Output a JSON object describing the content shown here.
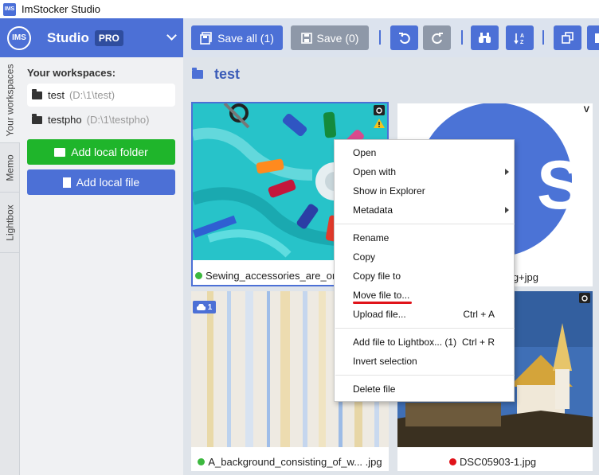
{
  "window": {
    "title": "ImStocker Studio",
    "icon_text": "IMS"
  },
  "header": {
    "logo_text": "IMS",
    "studio_label": "Studio",
    "pro_badge": "PRO",
    "save_all_label": "Save all (1)",
    "save_label": "Save (0)"
  },
  "left_tabs": [
    "Your workspaces",
    "Memo",
    "Lightbox"
  ],
  "workspaces": {
    "title": "Your workspaces:",
    "items": [
      {
        "name": "test",
        "path": "(D:\\1\\test)"
      },
      {
        "name": "testpho",
        "path": "(D:\\1\\testpho)"
      }
    ],
    "add_folder_label": "Add local folder",
    "add_file_label": "Add local file"
  },
  "main": {
    "folder_title": "test",
    "files": [
      {
        "name": "Sewing_accessories_are_or",
        "status_color": "#3cb83f"
      },
      {
        "name": "g+jpg",
        "status_color": ""
      },
      {
        "name": "A_background_consisting_of_w... .jpg",
        "status_color": "#3cb83f",
        "badge": "1"
      },
      {
        "name": "DSC05903-1.jpg",
        "status_color": "#e0131a"
      }
    ],
    "s_logo_letter": "S",
    "v_badge": "V"
  },
  "context_menu": {
    "items": [
      {
        "label": "Open"
      },
      {
        "label": "Open with",
        "submenu": true
      },
      {
        "label": "Show in Explorer"
      },
      {
        "label": "Metadata",
        "submenu": true
      },
      {
        "label": "Rename"
      },
      {
        "label": "Copy"
      },
      {
        "label": "Copy file to"
      },
      {
        "label": "Move file to..."
      },
      {
        "label": "Upload file...",
        "shortcut": "Ctrl + A"
      },
      {
        "label": "Add file to Lightbox... (1)",
        "shortcut": "Ctrl + R"
      },
      {
        "label": "Invert selection"
      },
      {
        "label": "Delete file"
      }
    ]
  },
  "colors": {
    "accent": "#4c70d6",
    "green": "#1fb52b",
    "toolbar_bg": "#dce3ee",
    "highlight": "#e0131a"
  }
}
